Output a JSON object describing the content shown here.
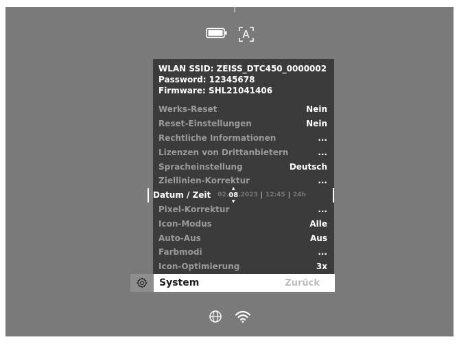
{
  "info": {
    "ssid": "WLAN SSID: ZEISS_DTC450_0000002",
    "password": "Password: 12345678",
    "firmware": "Firmware: SHL21041406"
  },
  "menu": [
    {
      "label": "Werks-Reset",
      "value": "Nein"
    },
    {
      "label": "Reset-Einstellungen",
      "value": "Nein"
    },
    {
      "label": "Rechtliche Informationen",
      "value": "..."
    },
    {
      "label": "Lizenzen von Drittanbietern",
      "value": "..."
    },
    {
      "label": "Spracheinstellung",
      "value": "Deutsch"
    },
    {
      "label": "Ziellinien-Korrektur",
      "value": "..."
    }
  ],
  "datetime": {
    "label": "Datum / Zeit",
    "day": "02.",
    "month": "08",
    "year": ".2023",
    "time": "12:45",
    "format": "24h",
    "separator": "|"
  },
  "menu2": [
    {
      "label": "Pixel-Korrektur",
      "value": "..."
    },
    {
      "label": "Icon-Modus",
      "value": "Alle"
    },
    {
      "label": "Auto-Aus",
      "value": "Aus"
    },
    {
      "label": "Farbmodi",
      "value": "..."
    },
    {
      "label": "Icon-Optimierung",
      "value": "3x"
    }
  ],
  "system_bar": {
    "title": "System",
    "back": "Zurück"
  },
  "icons": {
    "top": [
      "battery-icon",
      "auto-mode-icon"
    ],
    "bottom": [
      "globe-icon",
      "wifi-icon"
    ],
    "auto_mode_text": "A"
  }
}
